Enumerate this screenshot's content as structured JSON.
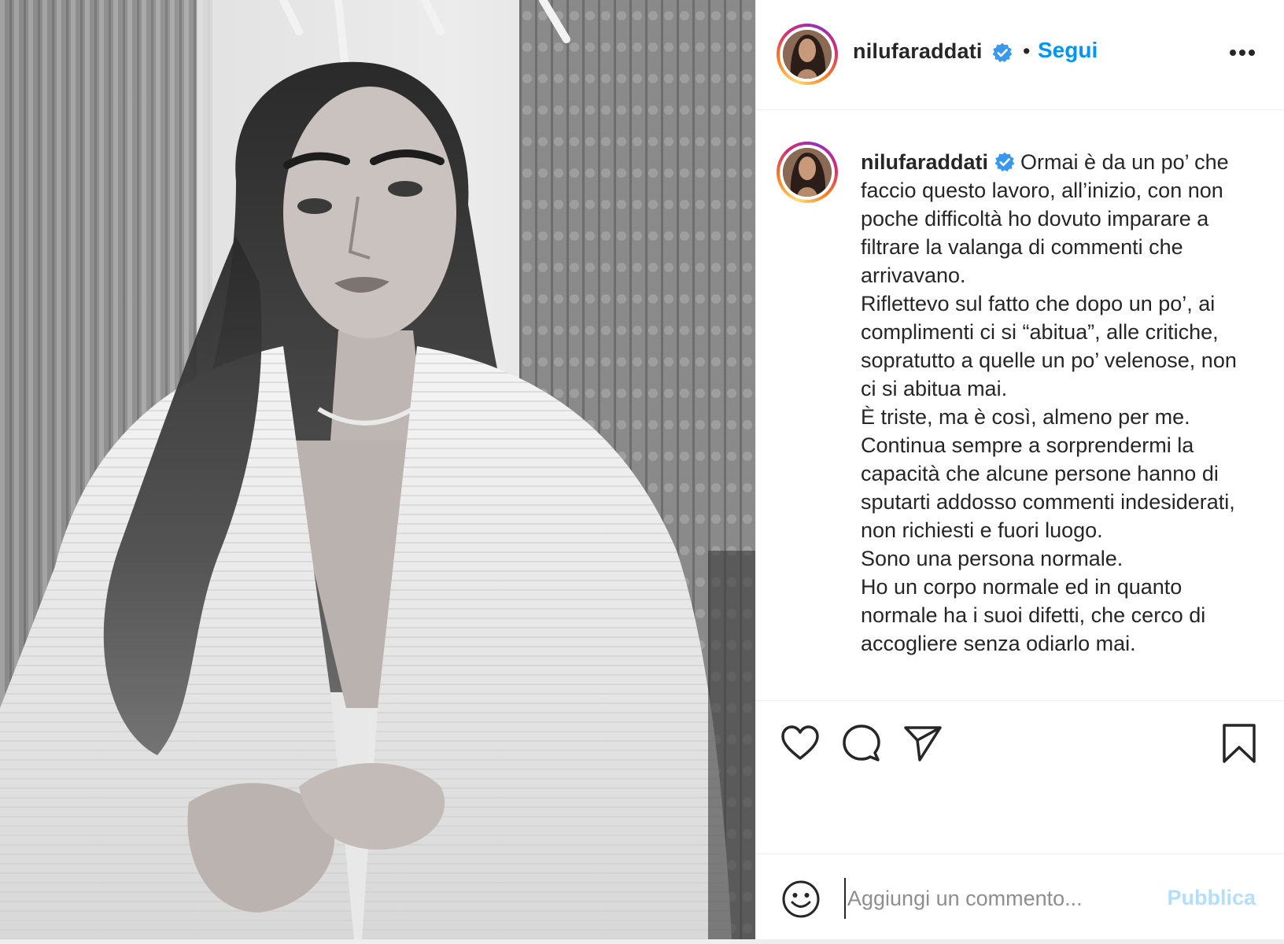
{
  "post": {
    "username": "nilufaraddati",
    "verified": true,
    "follow_label": "Segui",
    "separator": "•",
    "more_icon": "more-horizontal-icon",
    "photo_description_icon": "post-photo"
  },
  "caption": {
    "username": "nilufaraddati",
    "text": "Ormai è da un po’ che faccio questo lavoro, all’inizio, con non poche difficoltà ho dovuto imparare a filtrare la valanga di commenti che arrivavano.\nRiflettevo sul fatto che dopo un po’, ai complimenti ci si “abitua”, alle critiche, sopratutto a quelle un po’ velenose, non ci si abitua mai.\nÈ triste, ma è così, almeno per me.\nContinua sempre a sorprendermi la capacità che alcune persone hanno di sputarti addosso commenti indesiderati, non richiesti e fuori luogo.\nSono una persona normale.\nHo un corpo normale ed in quanto normale ha i suoi difetti, che cerco di accogliere senza odiarlo mai."
  },
  "actions": {
    "like_icon": "heart-icon",
    "comment_icon": "comment-icon",
    "share_icon": "send-icon",
    "save_icon": "bookmark-icon"
  },
  "comment_box": {
    "placeholder": "Aggiungi un commento...",
    "value": "",
    "publish_label": "Pubblica",
    "emoji_icon": "smiley-icon"
  },
  "colors": {
    "link_blue": "#0095f6",
    "publish_disabled": "#b2dffc",
    "verified_blue": "#3897f0",
    "text": "#262626",
    "border": "#efefef"
  }
}
